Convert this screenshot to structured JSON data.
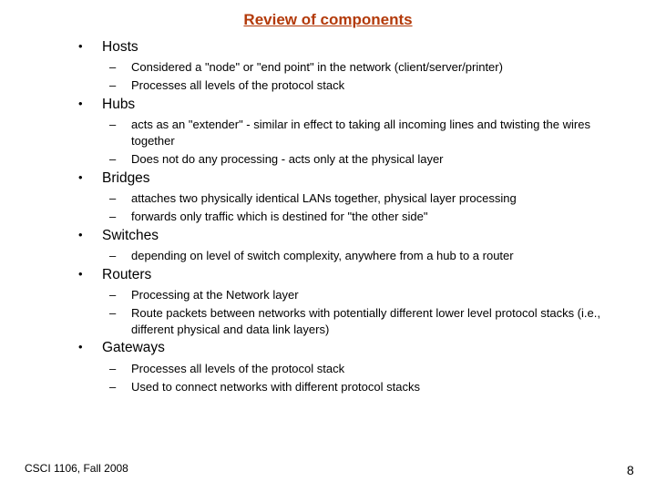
{
  "slide": {
    "title": "Review of components",
    "items": [
      {
        "label": "Hosts",
        "subitems": [
          "Considered a \"node\" or \"end point\" in the network (client/server/printer)",
          "Processes all levels of the protocol stack"
        ]
      },
      {
        "label": "Hubs",
        "subitems": [
          "acts as an \"extender\" - similar in effect to taking all incoming lines and twisting the wires together",
          "Does not do any processing - acts only at the physical layer"
        ]
      },
      {
        "label": "Bridges",
        "subitems": [
          "attaches two physically identical LANs together, physical layer processing",
          "forwards only traffic which is destined for \"the other side\""
        ]
      },
      {
        "label": "Switches",
        "subitems": [
          "depending on level of switch complexity, anywhere from a hub to a router"
        ]
      },
      {
        "label": "Routers",
        "subitems": [
          "Processing at the Network layer",
          "Route packets between networks with potentially different lower level protocol stacks (i.e., different physical and data link layers)"
        ]
      },
      {
        "label": "Gateways",
        "subitems": [
          "Processes all levels of the protocol stack",
          "Used to connect networks with different protocol stacks"
        ]
      }
    ],
    "bullet_glyph": "•",
    "dash_glyph": "–",
    "footer_text": "CSCI 1106, Fall 2008",
    "page_number": "8",
    "title_color": "#b33a0a"
  }
}
